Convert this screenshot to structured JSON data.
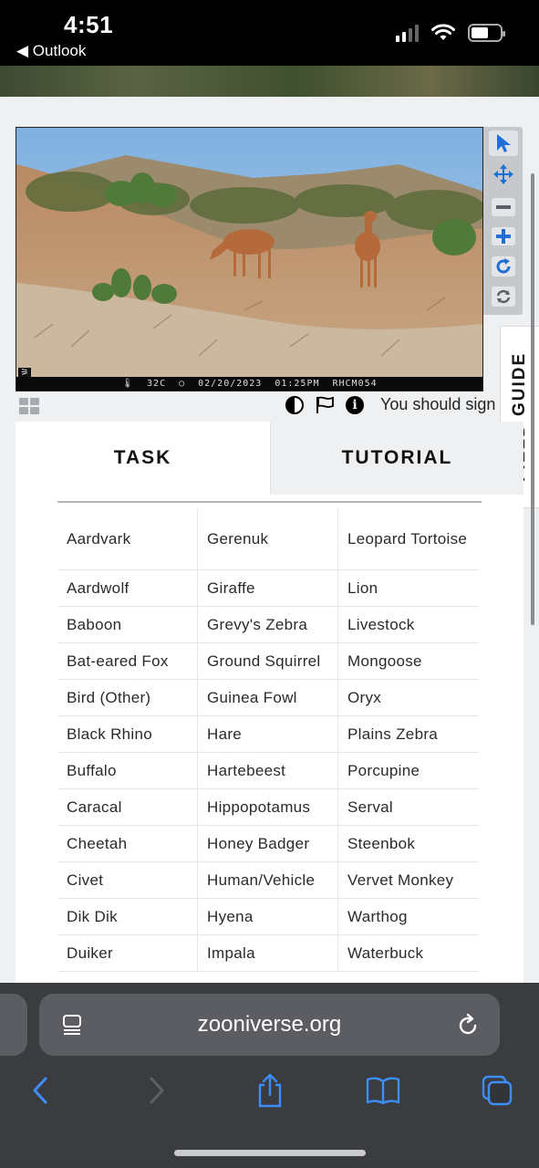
{
  "status_bar": {
    "time": "4:51",
    "back_label": "◀ Outlook"
  },
  "photo": {
    "temperature": "32C",
    "date": "02/20/2023",
    "time": "01:25PM",
    "camera_id": "RHCM054"
  },
  "tools": [
    {
      "name": "select-tool",
      "icon": "cursor-icon"
    },
    {
      "name": "pan-tool",
      "icon": "move-icon"
    },
    {
      "name": "zoom-out-tool",
      "icon": "minus-icon"
    },
    {
      "name": "zoom-in-tool",
      "icon": "plus-icon"
    },
    {
      "name": "rotate-tool",
      "icon": "rotate-icon"
    },
    {
      "name": "reset-tool",
      "icon": "reset-icon"
    }
  ],
  "meta": {
    "sign_in_text": "You should sign"
  },
  "tabs": {
    "task": "TASK",
    "tutorial": "TUTORIAL"
  },
  "field_guide": "FIELD GUIDE",
  "species": [
    [
      "Aardvark",
      "Gerenuk",
      "Leopard Tortoise"
    ],
    [
      "Aardwolf",
      "Giraffe",
      "Lion"
    ],
    [
      "Baboon",
      "Grevy's Zebra",
      "Livestock"
    ],
    [
      "Bat-eared Fox",
      "Ground Squirrel",
      "Mongoose"
    ],
    [
      "Bird (Other)",
      "Guinea Fowl",
      "Oryx"
    ],
    [
      "Black Rhino",
      "Hare",
      "Plains Zebra"
    ],
    [
      "Buffalo",
      "Hartebeest",
      "Porcupine"
    ],
    [
      "Caracal",
      "Hippopotamus",
      "Serval"
    ],
    [
      "Cheetah",
      "Honey Badger",
      "Steenbok"
    ],
    [
      "Civet",
      "Human/Vehicle",
      "Vervet Monkey"
    ],
    [
      "Dik Dik",
      "Hyena",
      "Warthog"
    ],
    [
      "Duiker",
      "Impala",
      "Waterbuck"
    ]
  ],
  "browser": {
    "url": "zooniverse.org"
  },
  "colors": {
    "accent": "#1f6fd6",
    "safari_bar": "#323438"
  }
}
